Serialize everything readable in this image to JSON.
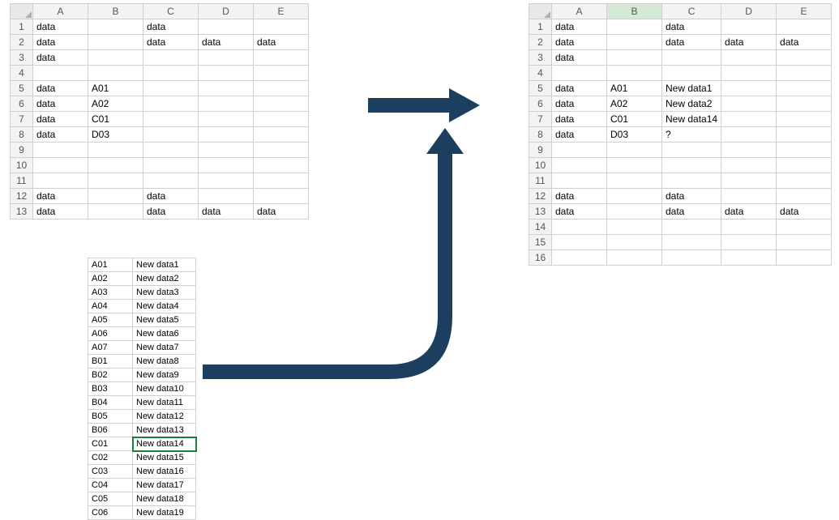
{
  "columns": [
    "A",
    "B",
    "C",
    "D",
    "E"
  ],
  "left_table": {
    "rows": 13,
    "cells": {
      "1": [
        "data",
        "",
        "data",
        "",
        ""
      ],
      "2": [
        "data",
        "",
        "data",
        "data",
        "data"
      ],
      "3": [
        "data",
        "",
        "",
        "",
        ""
      ],
      "4": [
        "",
        "",
        "",
        "",
        ""
      ],
      "5": [
        "data",
        "A01",
        "",
        "",
        ""
      ],
      "6": [
        "data",
        "A02",
        "",
        "",
        ""
      ],
      "7": [
        "data",
        "C01",
        "",
        "",
        ""
      ],
      "8": [
        "data",
        "D03",
        "",
        "",
        ""
      ],
      "9": [
        "",
        "",
        "",
        "",
        ""
      ],
      "10": [
        "",
        "",
        "",
        "",
        ""
      ],
      "11": [
        "",
        "",
        "",
        "",
        ""
      ],
      "12": [
        "data",
        "",
        "data",
        "",
        ""
      ],
      "13": [
        "data",
        "",
        "data",
        "data",
        "data"
      ]
    }
  },
  "right_table": {
    "rows": 16,
    "selected_col": "B",
    "cells": {
      "1": [
        "data",
        "",
        "data",
        "",
        ""
      ],
      "2": [
        "data",
        "",
        "data",
        "data",
        "data"
      ],
      "3": [
        "data",
        "",
        "",
        "",
        ""
      ],
      "4": [
        "",
        "",
        "",
        "",
        ""
      ],
      "5": [
        "data",
        "A01",
        "New data1",
        "",
        ""
      ],
      "6": [
        "data",
        "A02",
        "New data2",
        "",
        ""
      ],
      "7": [
        "data",
        "C01",
        "New data14",
        "",
        ""
      ],
      "8": [
        "data",
        "D03",
        "?",
        "",
        ""
      ],
      "9": [
        "",
        "",
        "",
        "",
        ""
      ],
      "10": [
        "",
        "",
        "",
        "",
        ""
      ],
      "11": [
        "",
        "",
        "",
        "",
        ""
      ],
      "12": [
        "data",
        "",
        "data",
        "",
        ""
      ],
      "13": [
        "data",
        "",
        "data",
        "data",
        "data"
      ],
      "14": [
        "",
        "",
        "",
        "",
        ""
      ],
      "15": [
        "",
        "",
        "",
        "",
        ""
      ],
      "16": [
        "",
        "",
        "",
        "",
        ""
      ]
    }
  },
  "lookup_table": {
    "selected_row": 14,
    "rows": [
      [
        "A01",
        "New data1"
      ],
      [
        "A02",
        "New data2"
      ],
      [
        "A03",
        "New data3"
      ],
      [
        "A04",
        "New data4"
      ],
      [
        "A05",
        "New data5"
      ],
      [
        "A06",
        "New data6"
      ],
      [
        "A07",
        "New data7"
      ],
      [
        "B01",
        "New data8"
      ],
      [
        "B02",
        "New data9"
      ],
      [
        "B03",
        "New data10"
      ],
      [
        "B04",
        "New data11"
      ],
      [
        "B05",
        "New data12"
      ],
      [
        "B06",
        "New data13"
      ],
      [
        "C01",
        "New data14"
      ],
      [
        "C02",
        "New data15"
      ],
      [
        "C03",
        "New data16"
      ],
      [
        "C04",
        "New data17"
      ],
      [
        "C05",
        "New data18"
      ],
      [
        "C06",
        "New data19"
      ]
    ]
  }
}
